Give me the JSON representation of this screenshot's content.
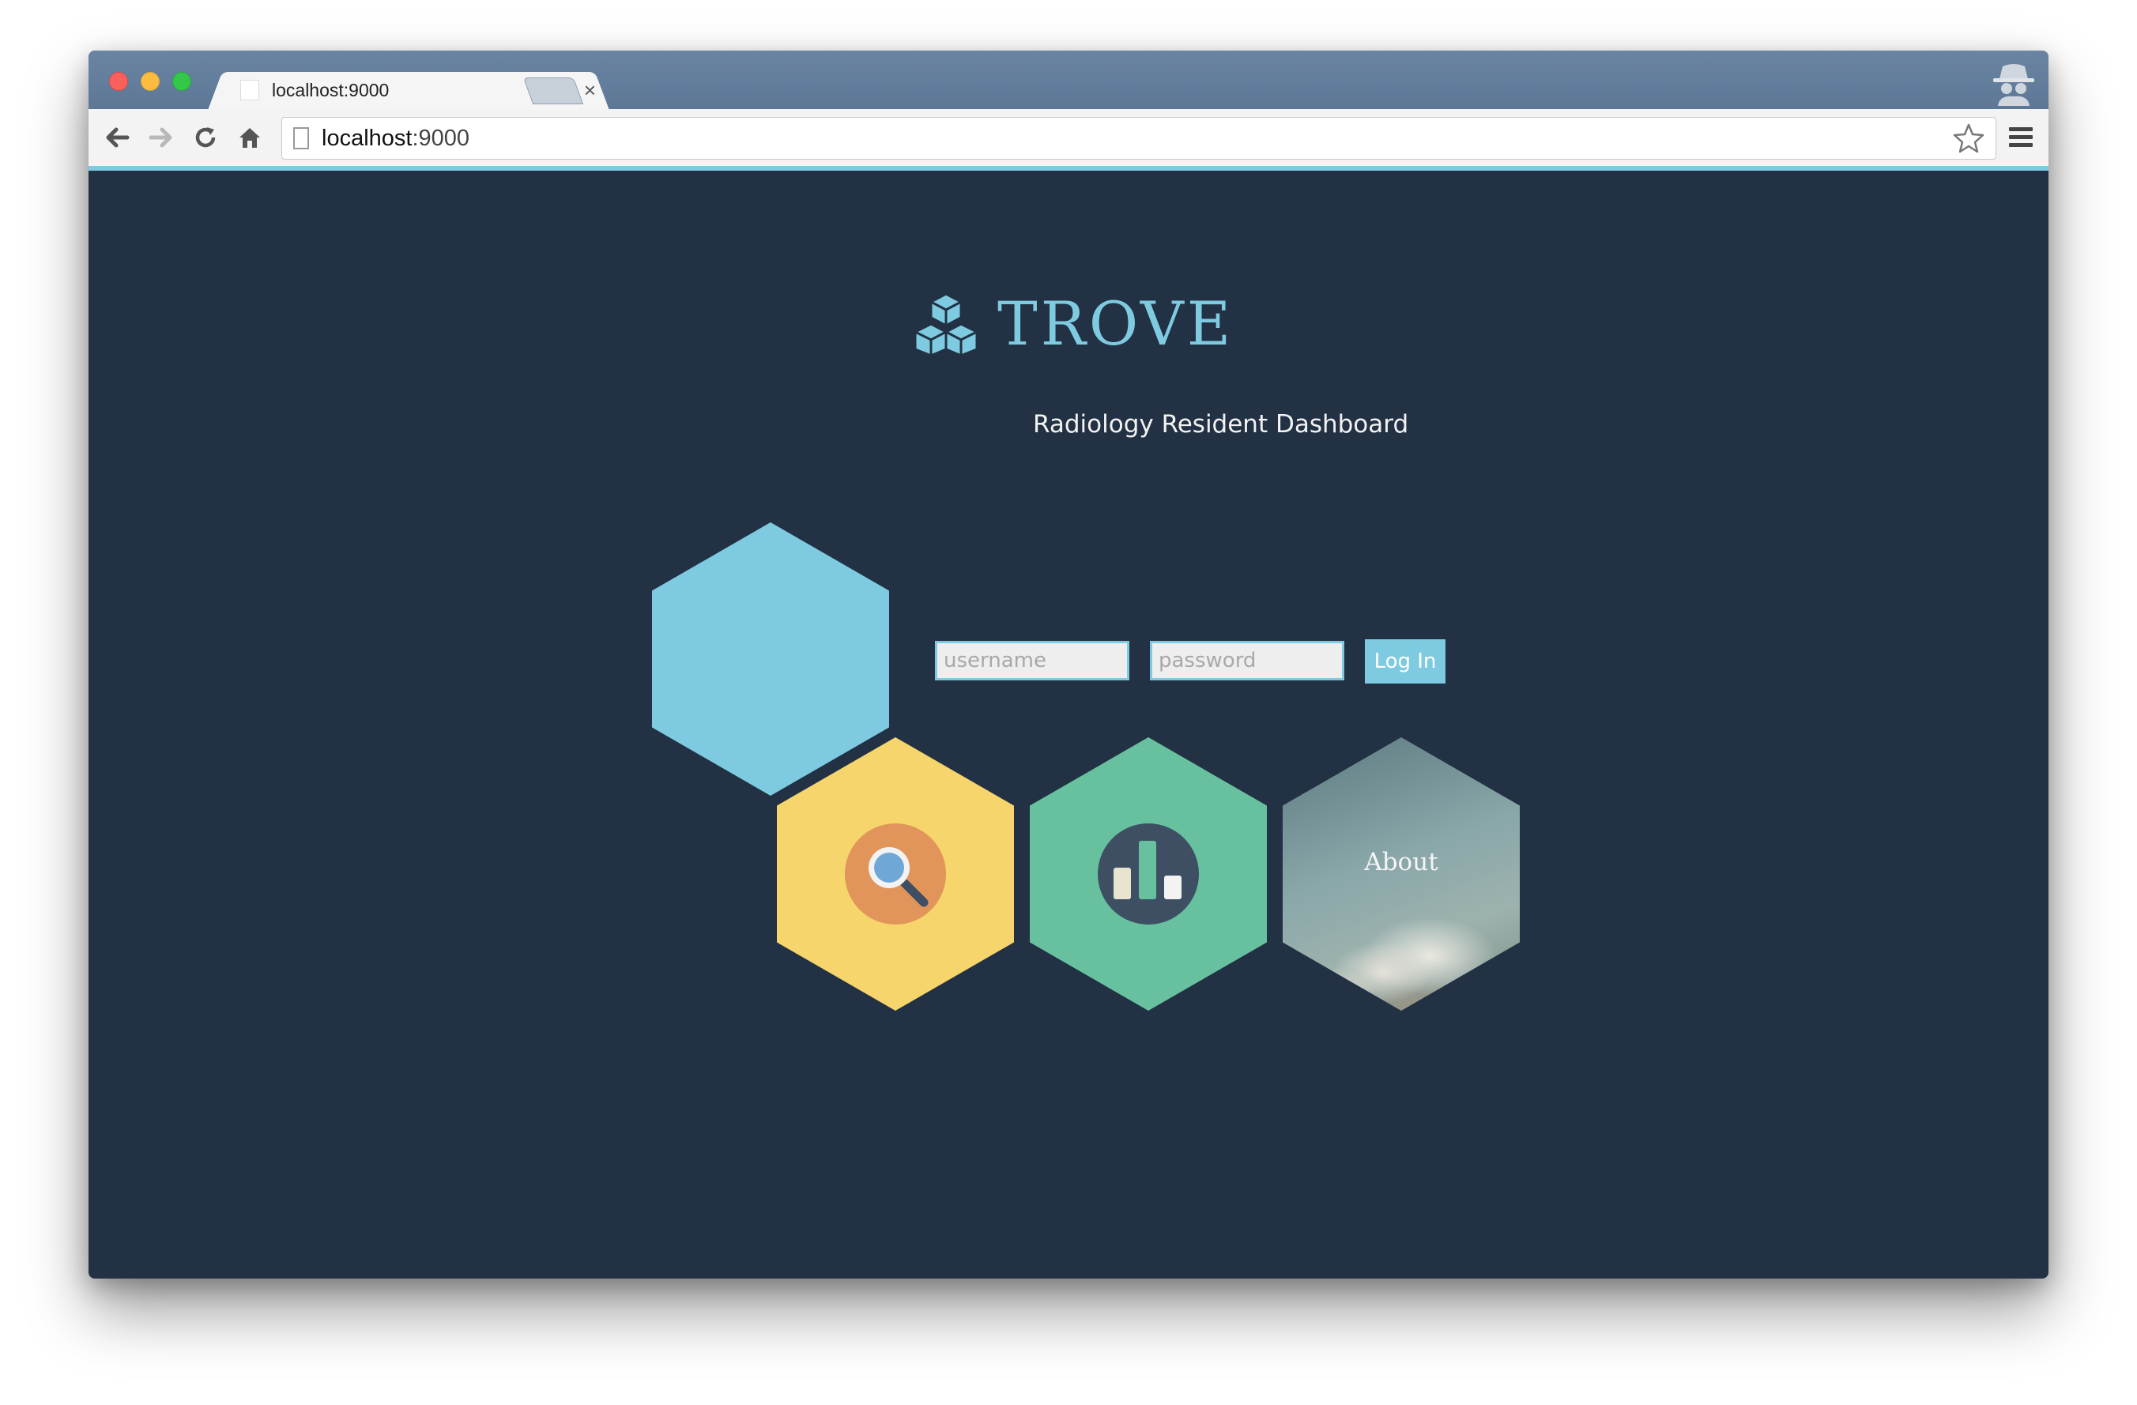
{
  "browser": {
    "tab": {
      "title": "localhost:9000",
      "close_label": "×"
    },
    "address_bar": {
      "host": "localhost",
      "port": ":9000"
    }
  },
  "header": {
    "logo_text": "TROVE",
    "subtitle": "Radiology Resident Dashboard"
  },
  "login": {
    "username_placeholder": "username",
    "password_placeholder": "password",
    "submit_label": "Log In"
  },
  "tiles": [
    {
      "name": "blue-hex",
      "color": "#7ecbe1"
    },
    {
      "name": "search-tile",
      "color": "#f5d56c",
      "icon": "search-icon"
    },
    {
      "name": "stats-tile",
      "color": "#67c19f",
      "icon": "bar-chart-icon"
    },
    {
      "name": "about-tile",
      "label": "About",
      "icon": "clouds-image"
    }
  ],
  "colors": {
    "page_background": "#223143",
    "accent": "#7ecbe1",
    "search_icon_circle": "#e1955a",
    "stats_icon_circle": "#3e4f63"
  }
}
